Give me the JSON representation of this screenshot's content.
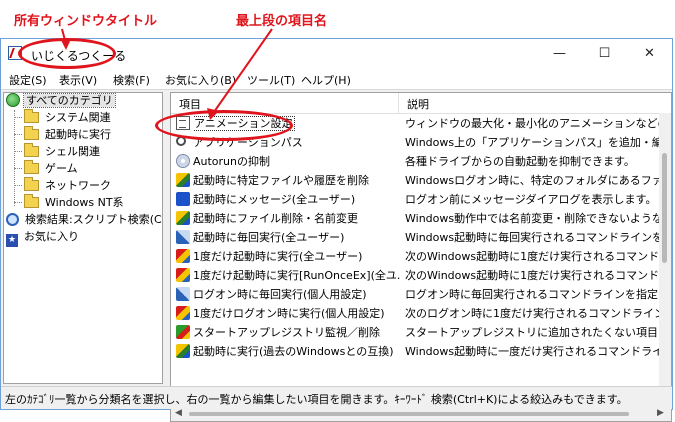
{
  "annotations": {
    "window_title_note": "所有ウィンドウタイトル",
    "top_item_note": "最上段の項目名"
  },
  "window": {
    "title": "いじくるつくーる",
    "minimize_glyph": "—",
    "maximize_glyph": "☐",
    "close_glyph": "✕"
  },
  "menu": [
    {
      "label": "設定(S)"
    },
    {
      "label": "表示(V)"
    },
    {
      "label": "検索(F)"
    },
    {
      "label": "お気に入り(B)"
    },
    {
      "label": "ツール(T)"
    },
    {
      "label": "ヘルプ(H)"
    }
  ],
  "tree": {
    "root": "すべてのカテゴリ",
    "children": [
      "システム関連",
      "起動時に実行",
      "シェル関連",
      "ゲーム",
      "ネットワーク",
      "Windows NT系"
    ],
    "search_results": "検索結果:スクリプト検索(Ct",
    "favorites": "お気に入り"
  },
  "list": {
    "header_name": "項目",
    "header_desc": "説明",
    "rows": [
      {
        "name": "アニメーション設定",
        "desc": "ウィンドウの最大化・最小化のアニメーションなどの抑制",
        "icon": "doc-icon"
      },
      {
        "name": "アプリケーションパス",
        "desc": "Windows上の「アプリケーションパス」を追加・編集・削除",
        "icon": "search-icon"
      },
      {
        "name": "Autorunの抑制",
        "desc": "各種ドライブからの自動起動を抑制できます。",
        "icon": "disc-icon"
      },
      {
        "name": "起動時に特定ファイルや履歴を削除",
        "desc": "Windowsログオン時に、特定のフォルダにあるファイルや",
        "icon": "run-icon"
      },
      {
        "name": "起動時にメッセージ(全ユーザー)",
        "desc": "ログオン前にメッセージダイアログを表示します。",
        "icon": "message-icon"
      },
      {
        "name": "起動時にファイル削除・名前変更",
        "desc": "Windows動作中では名前変更・削除できないようなファ",
        "icon": "run-icon"
      },
      {
        "name": "起動時に毎回実行(全ユーザー)",
        "desc": "Windows起動時に毎回実行されるコマンドラインを指定",
        "icon": "arrow-icon"
      },
      {
        "name": "1度だけ起動時に実行(全ユーザー)",
        "desc": "次のWindows起動時に1度だけ実行されるコマンドライン",
        "icon": "red-run-icon"
      },
      {
        "name": "1度だけ起動時に実行[RunOnceEx](全ユ...",
        "desc": "次のWindows起動時に1度だけ実行されるコマンドライン",
        "icon": "red-run-icon"
      },
      {
        "name": "ログオン時に毎回実行(個人用設定)",
        "desc": "ログオン時に毎回実行されるコマンドラインを指定します",
        "icon": "arrow-icon"
      },
      {
        "name": "1度だけログオン時に実行(個人用設定)",
        "desc": "次のログオン時に1度だけ実行されるコマンドラインを指",
        "icon": "red-run-icon"
      },
      {
        "name": "スタートアップレジストリ監視／削除",
        "desc": "スタートアップレジストリに追加されたくない項目を削除",
        "icon": "green-run-icon"
      },
      {
        "name": "起動時に実行(過去のWindowsとの互換)",
        "desc": "Windows起動時に一度だけ実行されるコマンドライン",
        "icon": "run-icon"
      }
    ]
  },
  "status": "左のｶﾃｺﾞﾘ一覧から分類名を選択し、右の一覧から編集したい項目を開きます。ｷｰﾜｰﾄﾞ 検索(Ctrl+K)による絞込みもできます。"
}
